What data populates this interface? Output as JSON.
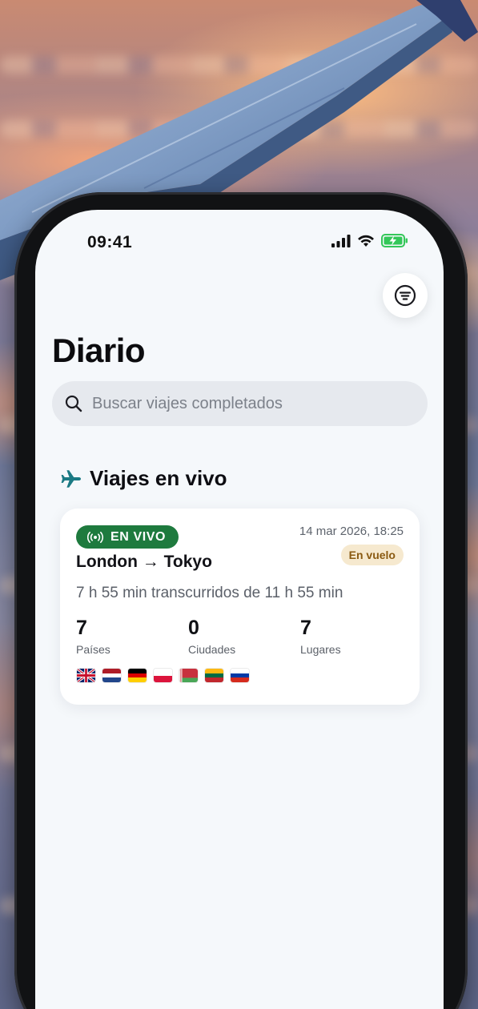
{
  "status_bar": {
    "time": "09:41"
  },
  "page": {
    "title": "Diario"
  },
  "search": {
    "placeholder": "Buscar viajes completados"
  },
  "section": {
    "title": "Viajes en vivo",
    "icon": "airplane-icon"
  },
  "trip_card": {
    "badge": "EN VIVO",
    "badge_icon": "broadcast-icon",
    "date": "14 mar 2026, 18:25",
    "status": "En vuelo",
    "route": "London → Tokyo",
    "elapsed": "7 h 55 min transcurridos de 11 h 55 min",
    "stats": [
      {
        "value": "7",
        "label": "Países"
      },
      {
        "value": "0",
        "label": "Ciudades"
      },
      {
        "value": "7",
        "label": "Lugares"
      }
    ],
    "flags": [
      "united-kingdom",
      "netherlands",
      "germany",
      "poland",
      "belarus",
      "lithuania",
      "russia"
    ]
  },
  "colors": {
    "live_badge": "#1e7a3e",
    "status_pill_bg": "#f6e9cf",
    "status_pill_text": "#8a5a12",
    "section_icon": "#1b7a84",
    "battery": "#34c759"
  }
}
